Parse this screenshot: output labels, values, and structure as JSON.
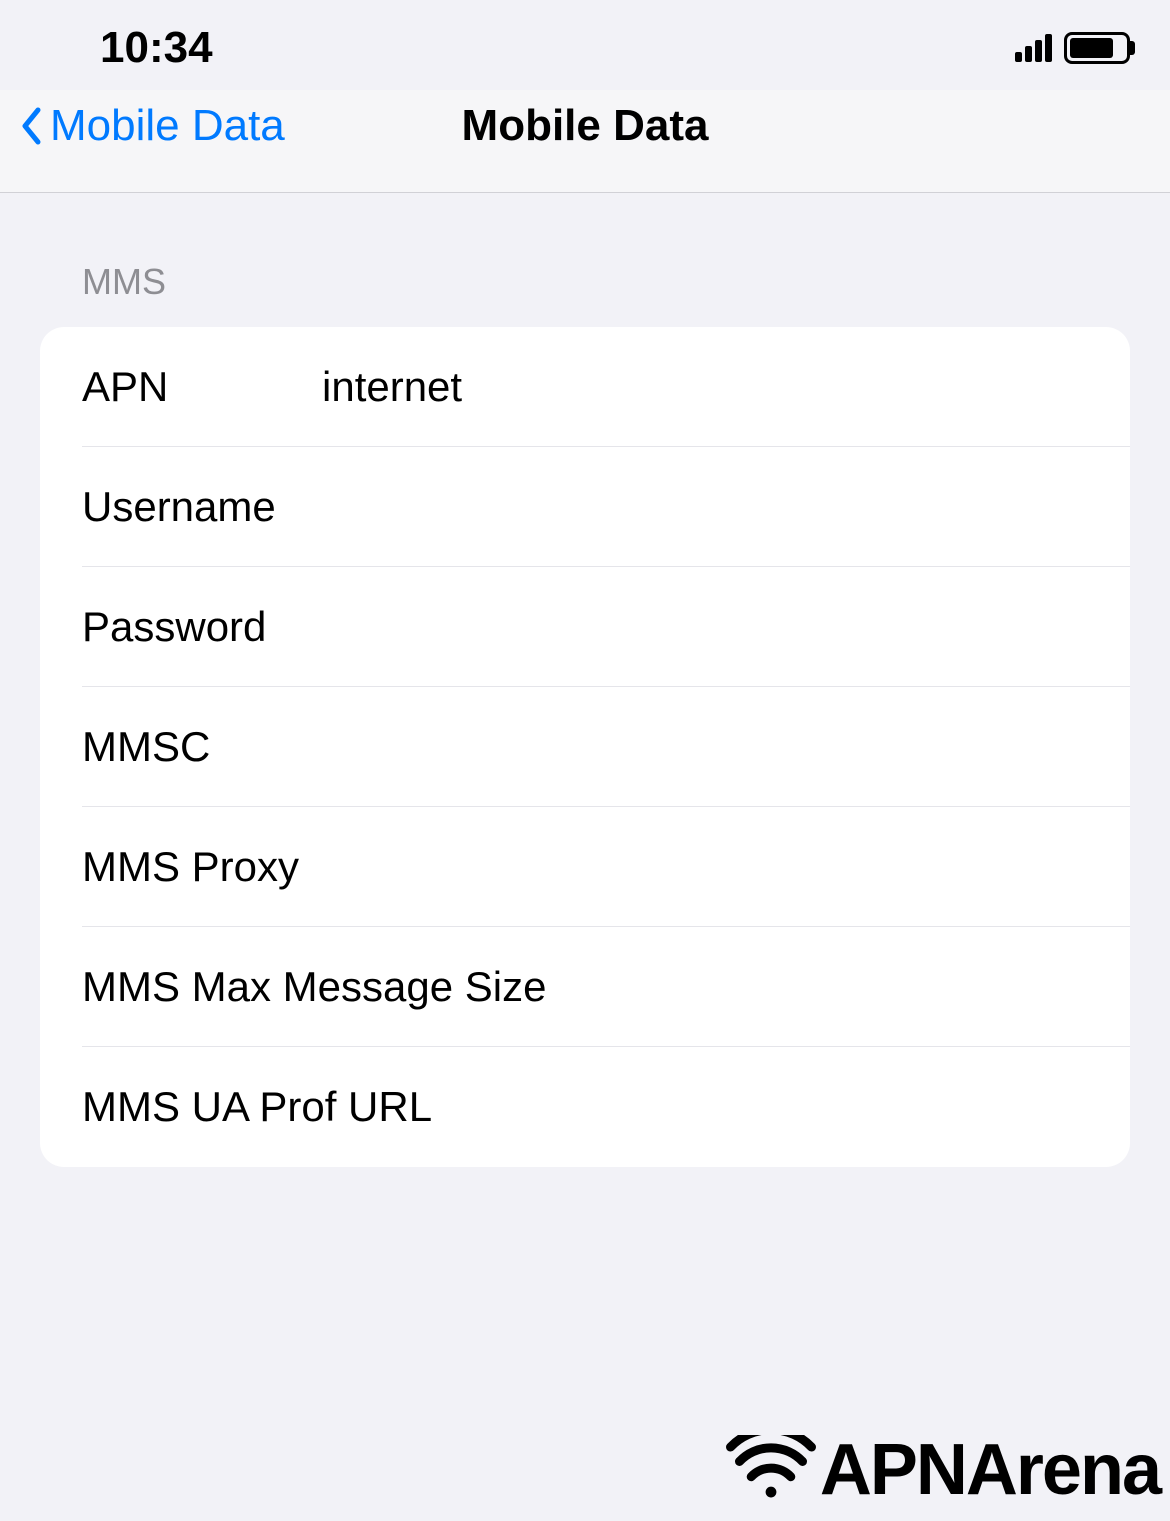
{
  "status": {
    "time": "10:34"
  },
  "nav": {
    "back_label": "Mobile Data",
    "title": "Mobile Data"
  },
  "section": {
    "header": "MMS"
  },
  "fields": {
    "apn": {
      "label": "APN",
      "value": "internet"
    },
    "username": {
      "label": "Username",
      "value": ""
    },
    "password": {
      "label": "Password",
      "value": ""
    },
    "mmsc": {
      "label": "MMSC",
      "value": ""
    },
    "mms_proxy": {
      "label": "MMS Proxy",
      "value": ""
    },
    "mms_max_size": {
      "label": "MMS Max Message Size",
      "value": ""
    },
    "mms_ua_prof": {
      "label": "MMS UA Prof URL",
      "value": ""
    }
  },
  "watermark": {
    "text": "APNArena",
    "bottom_text": "APNArena"
  }
}
